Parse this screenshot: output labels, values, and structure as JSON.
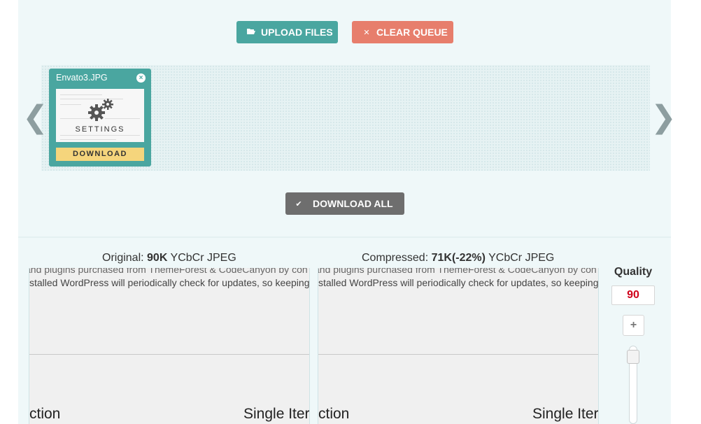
{
  "toolbar": {
    "upload_label": "UPLOAD FILES",
    "upload_icon": "folder-open-icon",
    "clear_label": "CLEAR QUEUE",
    "clear_icon": "x-icon",
    "download_all_label": "DOWNLOAD ALL",
    "download_all_icon": "checkmark-icon"
  },
  "queue": {
    "prev_glyph": "❮",
    "next_glyph": "❯",
    "items": [
      {
        "filename": "Envato3.JPG",
        "thumb_text": "SETTINGS",
        "download_label": "DOWNLOAD"
      }
    ]
  },
  "compare": {
    "original": {
      "prefix": "Original:",
      "size": "90K",
      "format": "YCbCr JPEG"
    },
    "compressed": {
      "prefix": "Compressed:",
      "size": "71K(-22%)",
      "format": "YCbCr JPEG"
    },
    "preview": {
      "line1": "and plugins purchased from ThemeForest & CodeCanyon by con",
      "line2": "stalled WordPress will periodically check for updates, so keeping",
      "bottom_left": "ction",
      "bottom_right": "Single Iter"
    }
  },
  "quality": {
    "label": "Quality",
    "value": "90",
    "plus_glyph": "+"
  },
  "colors": {
    "accent_teal": "#4aa6a0",
    "clear_red": "#e77e6c",
    "download_all_gray": "#6e6e6e",
    "download_yellow": "#f5d57c",
    "quality_red": "#d0021b"
  }
}
